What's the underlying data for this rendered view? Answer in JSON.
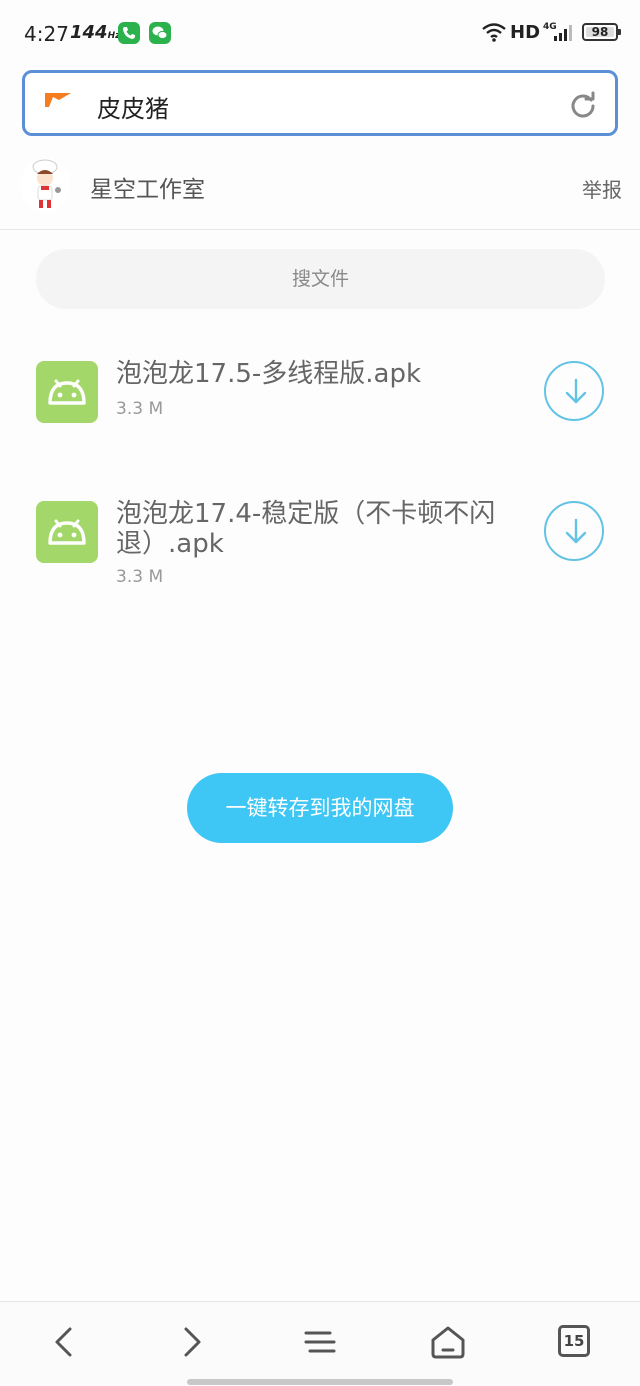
{
  "status_bar": {
    "time": "4:27",
    "refresh_rate": "144",
    "refresh_unit": "Hz",
    "network_hd": "HD",
    "network_type": "4G",
    "battery": "98"
  },
  "address_bar": {
    "text": "皮皮猪",
    "logo_icon": "orange-flag-logo",
    "reload_icon": "reload-icon"
  },
  "author": {
    "name": "星空工作室",
    "report_label": "举报",
    "avatar_icon": "chef-avatar"
  },
  "search_file_label": "搜文件",
  "files": [
    {
      "name": "泡泡龙17.5-多线程版.apk",
      "size": "3.3 M",
      "icon": "android-icon"
    },
    {
      "name": "泡泡龙17.4-稳定版（不卡顿不闪退）.apk",
      "size": "3.3 M",
      "icon": "android-icon"
    }
  ],
  "save_button_label": "一键转存到我的网盘",
  "bottom_nav": {
    "tabs_count": "15"
  },
  "colors": {
    "accent_blue": "#3ec6f4",
    "address_border": "#5b8fd6",
    "android_green": "#a4d76a",
    "download_ring": "#63c3e5"
  }
}
